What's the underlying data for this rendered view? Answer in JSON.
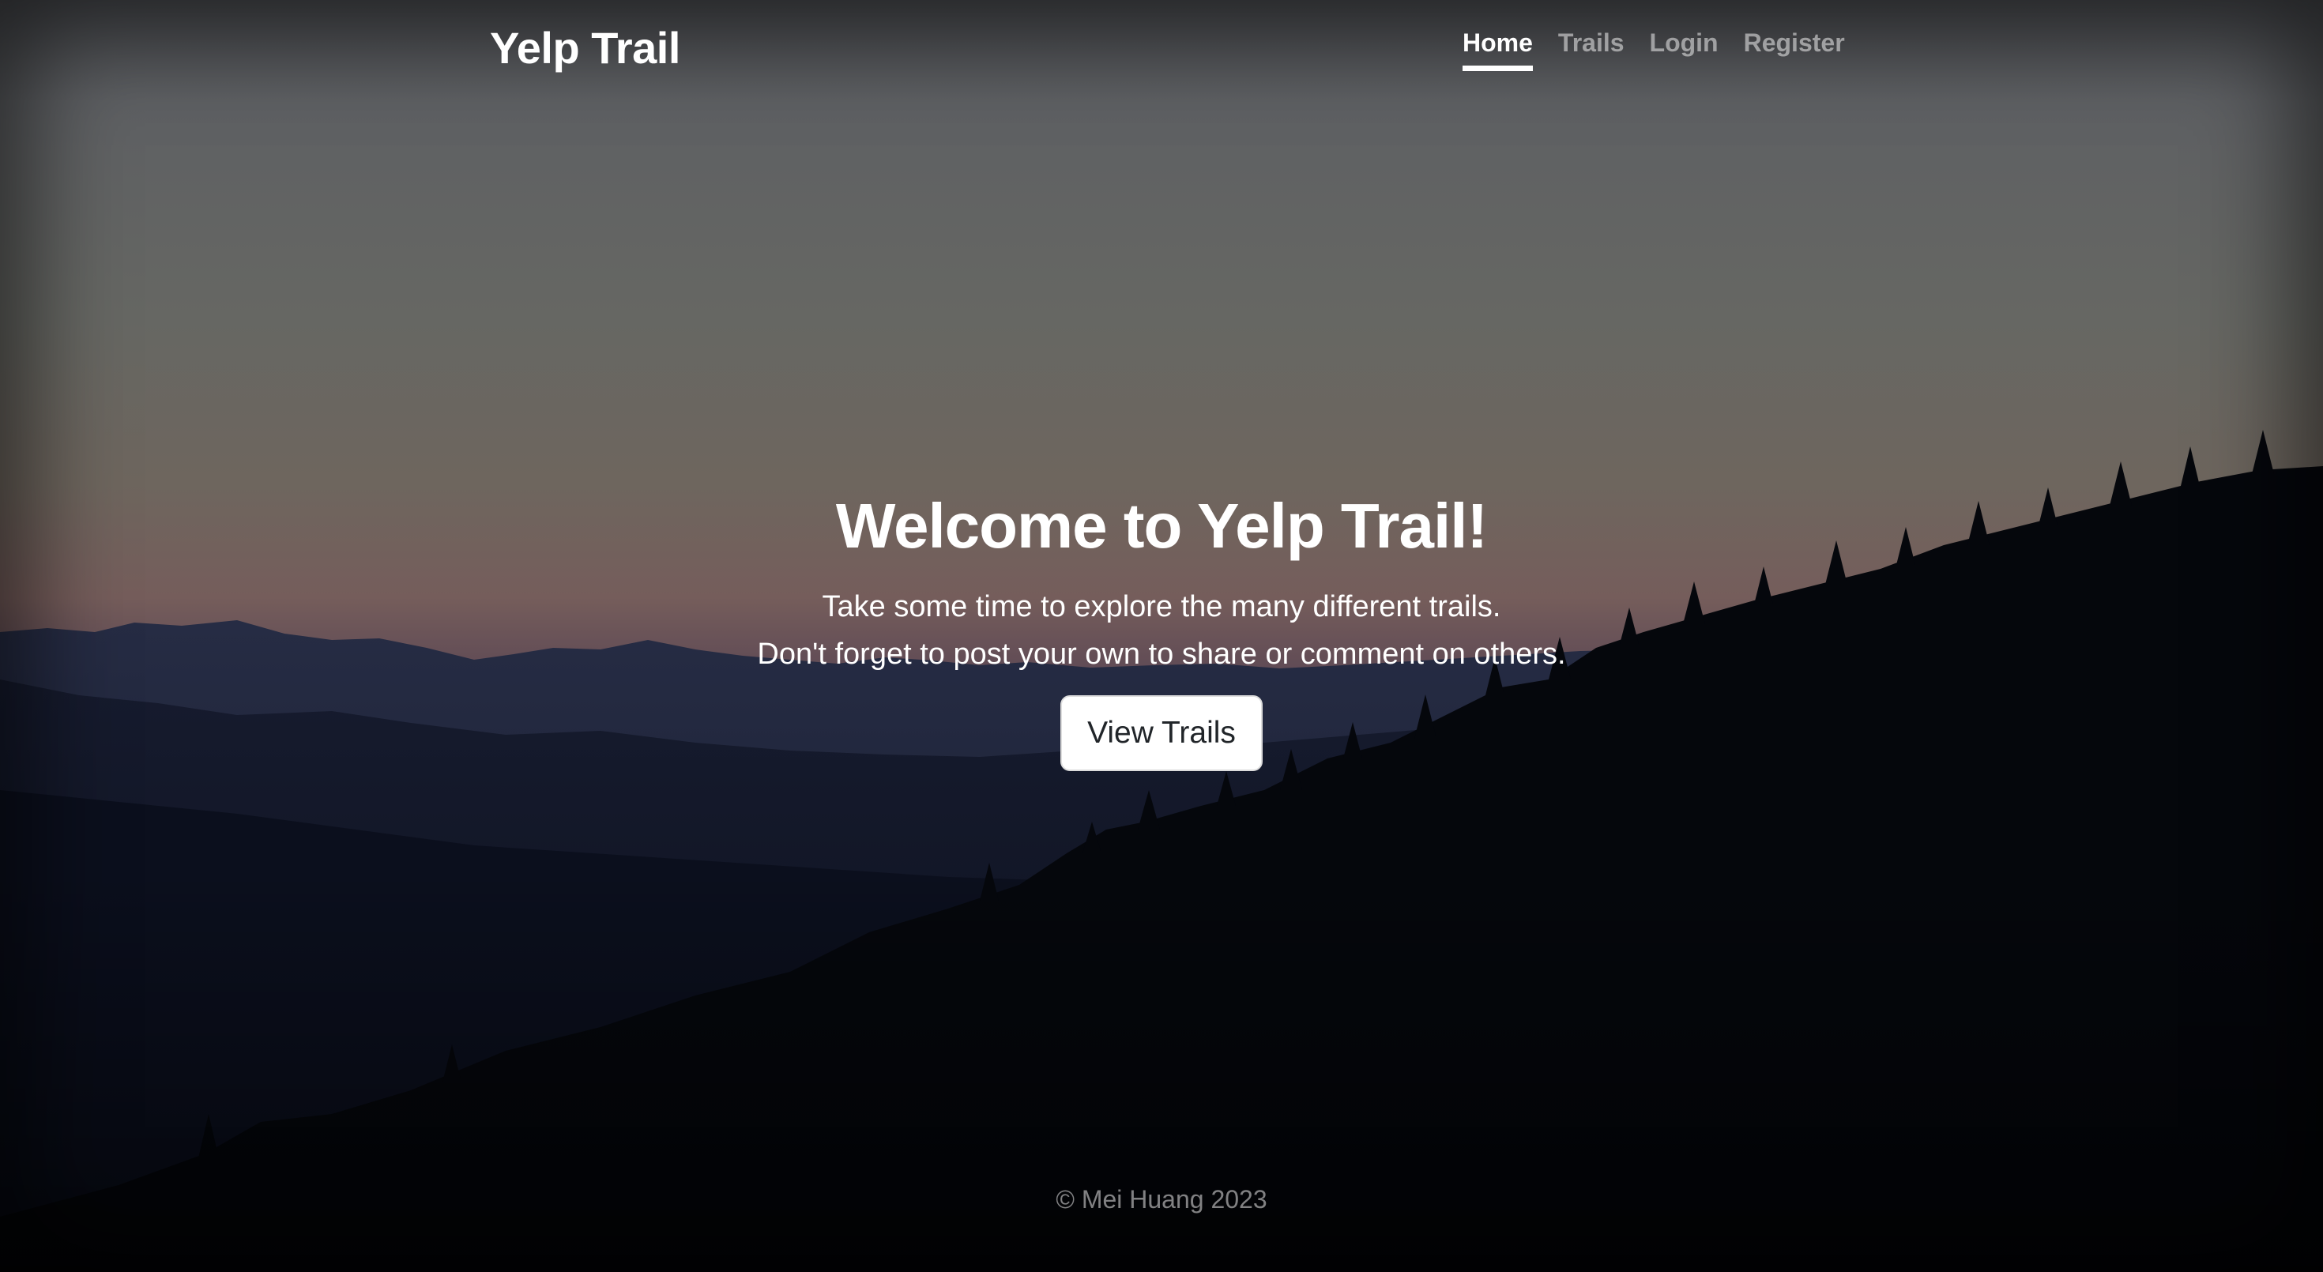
{
  "header": {
    "brand": "Yelp Trail",
    "nav": [
      {
        "label": "Home",
        "active": true
      },
      {
        "label": "Trails",
        "active": false
      },
      {
        "label": "Login",
        "active": false
      },
      {
        "label": "Register",
        "active": false
      }
    ]
  },
  "hero": {
    "title": "Welcome to Yelp Trail!",
    "lead_line1": "Take some time to explore the many different trails.",
    "lead_line2": "Don't forget to post your own to share or comment on others.",
    "button_label": "View Trails"
  },
  "footer": {
    "text": "© Mei Huang 2023"
  },
  "colors": {
    "text": "#ffffff",
    "muted_text": "rgba(255,255,255,0.5)",
    "button_bg": "#ffffff",
    "button_text": "#212529",
    "sky_top": "#5c5f62",
    "sky_horizon": "#7a5c5a",
    "mountains": "#141a2c",
    "forest": "#05070d"
  },
  "background": {
    "description_icon": "mountain-sunset-background"
  }
}
